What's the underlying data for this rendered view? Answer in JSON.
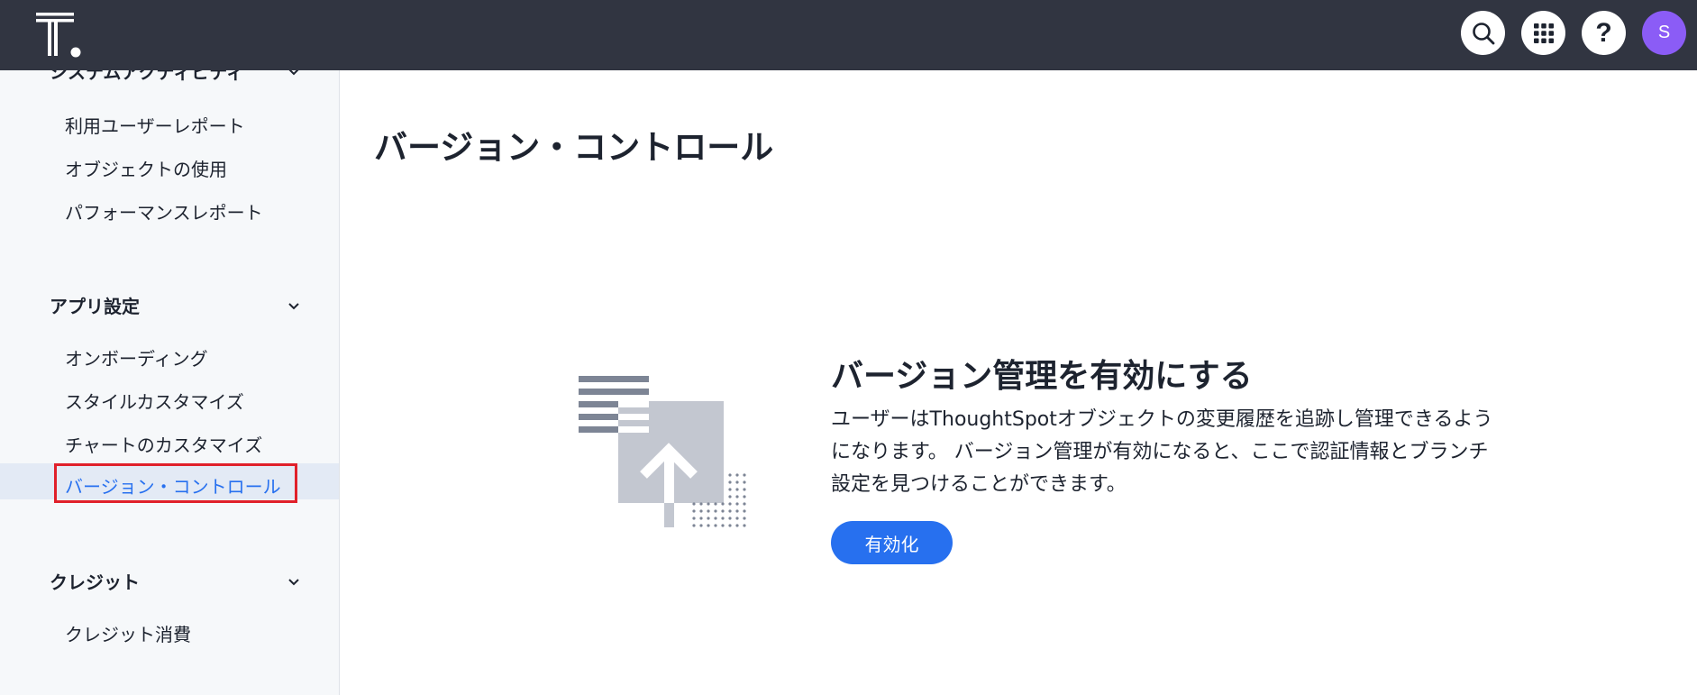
{
  "header": {
    "logo_icon": "thoughtspot-logo",
    "icons": [
      "search-icon",
      "apps-grid-icon",
      "help-icon",
      "avatar"
    ],
    "avatar_initial": "S",
    "avatar_color": "#8b5cf6",
    "bar_color": "#313541"
  },
  "sidebar": {
    "partial_section_label": "システムアクティビティ",
    "partial_items": [
      {
        "label": "利用ユーザーレポート"
      },
      {
        "label": "オブジェクトの使用"
      },
      {
        "label": "パフォーマンスレポート"
      }
    ],
    "app_settings": {
      "label": "アプリ設定",
      "items": [
        {
          "label": "オンボーディング"
        },
        {
          "label": "スタイルカスタマイズ"
        },
        {
          "label": "チャートのカスタマイズ"
        },
        {
          "label": "バージョン・コントロール",
          "active": true
        }
      ]
    },
    "credits": {
      "label": "クレジット",
      "items": [
        {
          "label": "クレジット消費"
        }
      ]
    }
  },
  "main": {
    "title": "バージョン・コントロール",
    "empty_state": {
      "illustration_icon": "version-upload-illustration",
      "heading": "バージョン管理を有効にする",
      "description": "ユーザーはThoughtSpotオブジェクトの変更履歴を追跡し管理できるようになります。 バージョン管理が有効になると、ここで認証情報とブランチ設定を見つけることができます。",
      "button_label": "有効化"
    }
  },
  "colors": {
    "accent": "#2770ef",
    "highlight_border": "#e0202a"
  }
}
